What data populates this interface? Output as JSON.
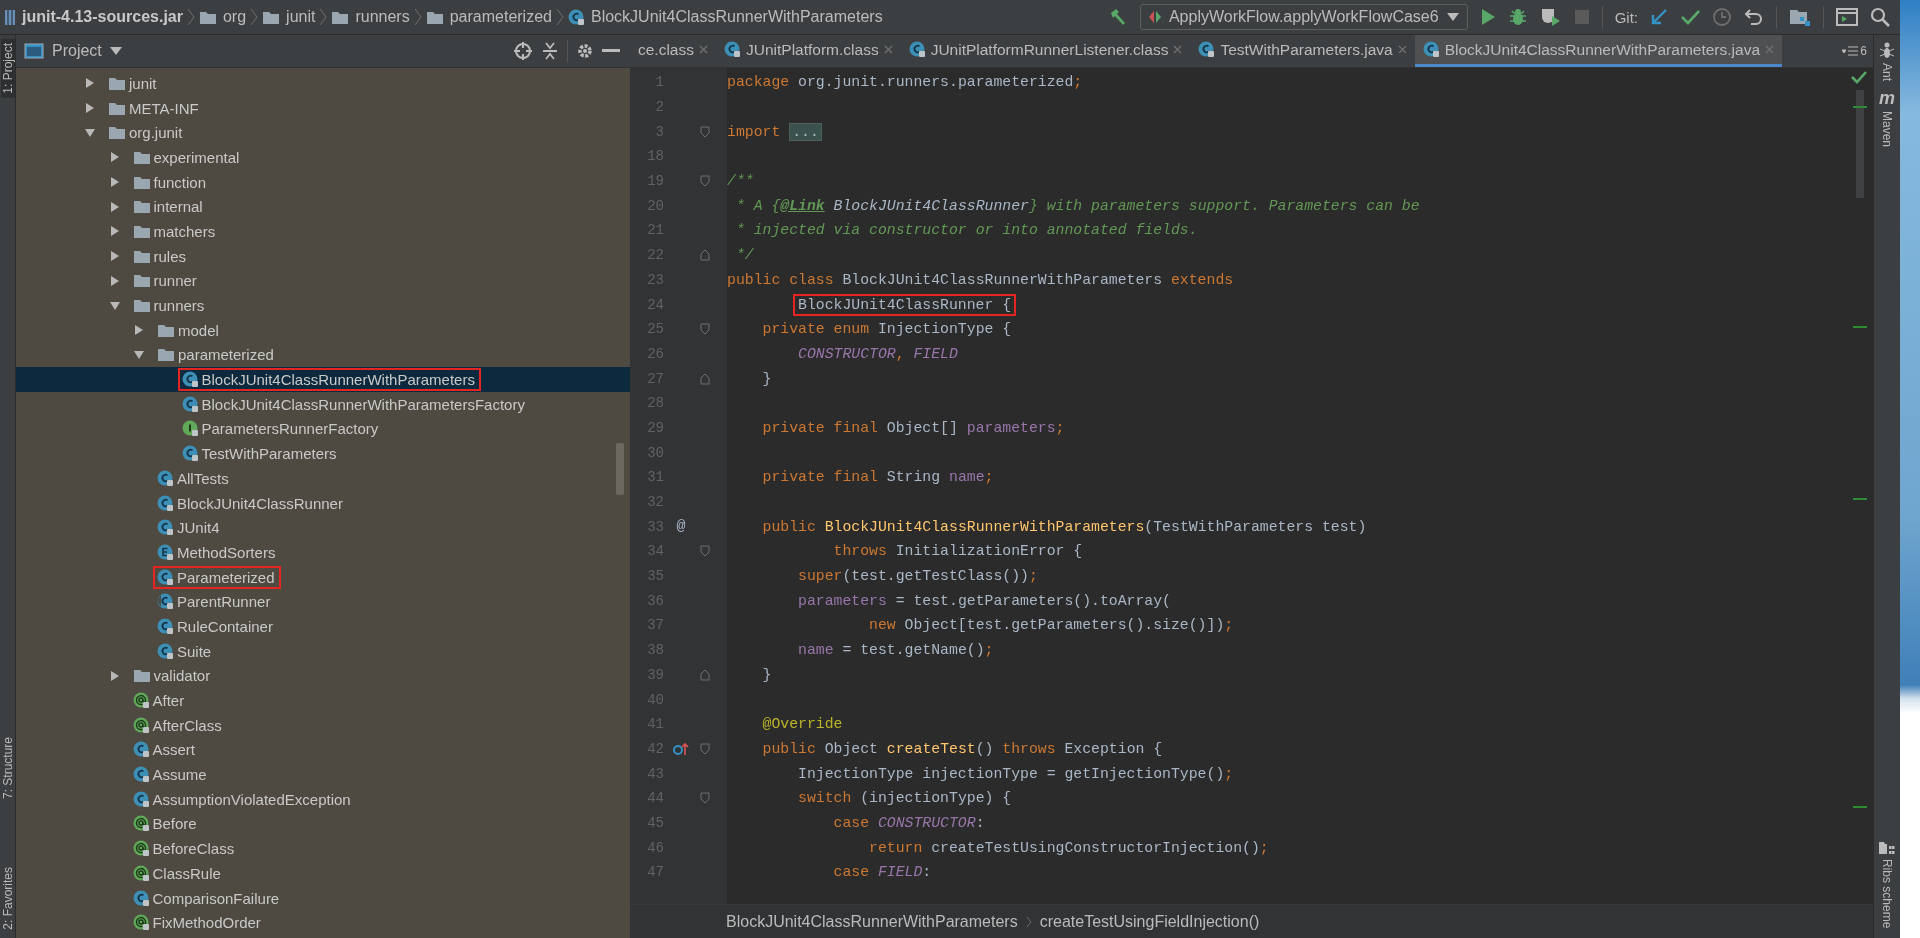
{
  "breadcrumb": [
    {
      "kind": "jar",
      "label": "junit-4.13-sources.jar"
    },
    {
      "kind": "folder",
      "label": "org"
    },
    {
      "kind": "folder",
      "label": "junit"
    },
    {
      "kind": "folder",
      "label": "runners"
    },
    {
      "kind": "folder",
      "label": "parameterized"
    },
    {
      "kind": "class",
      "label": "BlockJUnit4ClassRunnerWithParameters"
    }
  ],
  "toolbar": {
    "run_config": "ApplyWorkFlow.applyWorkFlowCase6",
    "git_label": "Git:"
  },
  "left_tool_strip": [
    {
      "label": "1: Project",
      "selected": true
    },
    {
      "label": "7: Structure",
      "selected": false
    },
    {
      "label": "2: Favorites",
      "selected": false
    }
  ],
  "project_panel": {
    "title": "Project",
    "tree": [
      {
        "kind": "folder",
        "label": "junit",
        "expanded": false
      },
      {
        "kind": "folder",
        "label": "META-INF",
        "expanded": false
      },
      {
        "kind": "folder",
        "label": "org.junit",
        "expanded": true,
        "children": [
          {
            "kind": "folder",
            "label": "experimental",
            "expanded": false
          },
          {
            "kind": "folder",
            "label": "function",
            "expanded": false
          },
          {
            "kind": "folder",
            "label": "internal",
            "expanded": false
          },
          {
            "kind": "folder",
            "label": "matchers",
            "expanded": false
          },
          {
            "kind": "folder",
            "label": "rules",
            "expanded": false
          },
          {
            "kind": "folder",
            "label": "runner",
            "expanded": false
          },
          {
            "kind": "folder",
            "label": "runners",
            "expanded": true,
            "children": [
              {
                "kind": "folder",
                "label": "model",
                "expanded": false
              },
              {
                "kind": "folder",
                "label": "parameterized",
                "expanded": true,
                "children": [
                  {
                    "kind": "class",
                    "label": "BlockJUnit4ClassRunnerWithParameters",
                    "selected": true,
                    "highlighted": true
                  },
                  {
                    "kind": "class",
                    "label": "BlockJUnit4ClassRunnerWithParametersFactory",
                    "selected": false,
                    "highlighted": false
                  },
                  {
                    "kind": "interface",
                    "label": "ParametersRunnerFactory",
                    "selected": false,
                    "highlighted": false
                  },
                  {
                    "kind": "class",
                    "label": "TestWithParameters",
                    "selected": false,
                    "highlighted": false
                  }
                ]
              },
              {
                "kind": "class",
                "label": "AllTests",
                "selected": false,
                "highlighted": false
              },
              {
                "kind": "class",
                "label": "BlockJUnit4ClassRunner",
                "selected": false,
                "highlighted": false
              },
              {
                "kind": "class",
                "label": "JUnit4",
                "selected": false,
                "highlighted": false
              },
              {
                "kind": "enum",
                "label": "MethodSorters",
                "selected": false,
                "highlighted": false
              },
              {
                "kind": "class",
                "label": "Parameterized",
                "selected": false,
                "highlighted": true
              },
              {
                "kind": "abstract",
                "label": "ParentRunner",
                "selected": false,
                "highlighted": false
              },
              {
                "kind": "class",
                "label": "RuleContainer",
                "selected": false,
                "highlighted": false
              },
              {
                "kind": "class",
                "label": "Suite",
                "selected": false,
                "highlighted": false
              }
            ]
          },
          {
            "kind": "folder",
            "label": "validator",
            "expanded": false
          },
          {
            "kind": "annotation",
            "label": "After",
            "selected": false,
            "highlighted": false
          },
          {
            "kind": "annotation",
            "label": "AfterClass",
            "selected": false,
            "highlighted": false
          },
          {
            "kind": "class",
            "label": "Assert",
            "selected": false,
            "highlighted": false
          },
          {
            "kind": "class",
            "label": "Assume",
            "selected": false,
            "highlighted": false
          },
          {
            "kind": "class",
            "label": "AssumptionViolatedException",
            "selected": false,
            "highlighted": false
          },
          {
            "kind": "annotation",
            "label": "Before",
            "selected": false,
            "highlighted": false
          },
          {
            "kind": "annotation",
            "label": "BeforeClass",
            "selected": false,
            "highlighted": false
          },
          {
            "kind": "annotation",
            "label": "ClassRule",
            "selected": false,
            "highlighted": false
          },
          {
            "kind": "class",
            "label": "ComparisonFailure",
            "selected": false,
            "highlighted": false
          },
          {
            "kind": "annotation",
            "label": "FixMethodOrder",
            "selected": false,
            "highlighted": false
          }
        ]
      }
    ]
  },
  "editor": {
    "tabs": [
      {
        "label": "ce.class",
        "has_icon": false,
        "selected": false
      },
      {
        "label": "JUnitPlatform.class",
        "has_icon": true,
        "selected": false
      },
      {
        "label": "JUnitPlatformRunnerListener.class",
        "has_icon": true,
        "selected": false
      },
      {
        "label": "TestWithParameters.java",
        "has_icon": true,
        "selected": false
      },
      {
        "label": "BlockJUnit4ClassRunnerWithParameters.java",
        "has_icon": true,
        "selected": true
      }
    ],
    "overflow_count": "6",
    "lines": [
      {
        "number": "1",
        "fold_start": false,
        "fold_end": false,
        "segments": [
          {
            "kind": "keyword",
            "text": "package"
          },
          {
            "kind": "plain",
            "text": " org.junit.runners.parameterized"
          },
          {
            "kind": "keyword",
            "text": ";"
          }
        ]
      },
      {
        "number": "2",
        "fold_start": false,
        "fold_end": false
      },
      {
        "number": "3",
        "fold_start": true,
        "fold_end": false,
        "segments": [
          {
            "kind": "keyword",
            "text": "import "
          },
          {
            "kind": "folded",
            "text": "..."
          }
        ]
      },
      {
        "number": "18",
        "fold_start": false,
        "fold_end": false
      },
      {
        "number": "19",
        "fold_start": true,
        "fold_end": false,
        "segments": [
          {
            "kind": "comment",
            "text": "/**"
          }
        ]
      },
      {
        "number": "20",
        "fold_start": false,
        "fold_end": false,
        "segments": [
          {
            "kind": "comment",
            "text": " * A {"
          },
          {
            "kind": "doc_tag",
            "text": "@Link"
          },
          {
            "kind": "doc_ref",
            "text": " BlockJUnit4ClassRunner"
          },
          {
            "kind": "comment",
            "text": "} with parameters support. Parameters can be"
          }
        ]
      },
      {
        "number": "21",
        "fold_start": false,
        "fold_end": false,
        "segments": [
          {
            "kind": "comment",
            "text": " * injected via constructor or into annotated fields."
          }
        ]
      },
      {
        "number": "22",
        "fold_start": false,
        "fold_end": true,
        "segments": [
          {
            "kind": "comment",
            "text": " */"
          }
        ]
      },
      {
        "number": "23",
        "fold_start": false,
        "fold_end": false,
        "segments": [
          {
            "kind": "keyword",
            "text": "public class "
          },
          {
            "kind": "plain",
            "text": "BlockJUnit4ClassRunnerWithParameters "
          },
          {
            "kind": "keyword",
            "text": "extends"
          }
        ]
      },
      {
        "number": "24",
        "fold_start": false,
        "fold_end": false,
        "wrapped": true,
        "segments": [
          {
            "kind": "plain",
            "text": "BlockJUnit4ClassRunner {",
            "highlighted": true
          }
        ]
      },
      {
        "number": "25",
        "fold_start": true,
        "fold_end": false,
        "segments": [
          {
            "kind": "keyword",
            "text": "    private enum "
          },
          {
            "kind": "plain",
            "text": "InjectionType {"
          }
        ]
      },
      {
        "number": "26",
        "fold_start": false,
        "fold_end": false,
        "segments": [
          {
            "kind": "constant",
            "text": "        CONSTRUCTOR"
          },
          {
            "kind": "keyword",
            "text": ", "
          },
          {
            "kind": "constant",
            "text": "FIELD"
          }
        ]
      },
      {
        "number": "27",
        "fold_start": false,
        "fold_end": true,
        "segments": [
          {
            "kind": "plain",
            "text": "    }"
          }
        ]
      },
      {
        "number": "28",
        "fold_start": false,
        "fold_end": false
      },
      {
        "number": "29",
        "fold_start": false,
        "fold_end": false,
        "segments": [
          {
            "kind": "keyword",
            "text": "    private final "
          },
          {
            "kind": "plain",
            "text": "Object[] "
          },
          {
            "kind": "field",
            "text": "parameters"
          },
          {
            "kind": "keyword",
            "text": ";"
          }
        ]
      },
      {
        "number": "30",
        "fold_start": false,
        "fold_end": false
      },
      {
        "number": "31",
        "fold_start": false,
        "fold_end": false,
        "segments": [
          {
            "kind": "keyword",
            "text": "    private final "
          },
          {
            "kind": "plain",
            "text": "String "
          },
          {
            "kind": "field",
            "text": "name"
          },
          {
            "kind": "keyword",
            "text": ";"
          }
        ]
      },
      {
        "number": "32",
        "fold_start": false,
        "fold_end": false
      },
      {
        "number": "33",
        "fold_start": false,
        "fold_end": false,
        "gutter_text": "@",
        "segments": [
          {
            "kind": "keyword",
            "text": "    public "
          },
          {
            "kind": "method",
            "text": "BlockJUnit4ClassRunnerWithParameters"
          },
          {
            "kind": "plain",
            "text": "(TestWithParameters test)"
          }
        ]
      },
      {
        "number": "34",
        "fold_start": true,
        "fold_end": false,
        "segments": [
          {
            "kind": "keyword",
            "text": "            throws "
          },
          {
            "kind": "plain",
            "text": "InitializationError {"
          }
        ]
      },
      {
        "number": "35",
        "fold_start": false,
        "fold_end": false,
        "segments": [
          {
            "kind": "keyword",
            "text": "        super"
          },
          {
            "kind": "plain",
            "text": "(test.getTestClass())"
          },
          {
            "kind": "keyword",
            "text": ";"
          }
        ]
      },
      {
        "number": "36",
        "fold_start": false,
        "fold_end": false,
        "segments": [
          {
            "kind": "field",
            "text": "        parameters"
          },
          {
            "kind": "plain",
            "text": " = test.getParameters().toArray("
          }
        ]
      },
      {
        "number": "37",
        "fold_start": false,
        "fold_end": false,
        "segments": [
          {
            "kind": "keyword",
            "text": "                new "
          },
          {
            "kind": "plain",
            "text": "Object[test.getParameters().size()])"
          },
          {
            "kind": "keyword",
            "text": ";"
          }
        ]
      },
      {
        "number": "38",
        "fold_start": false,
        "fold_end": false,
        "segments": [
          {
            "kind": "field",
            "text": "        name"
          },
          {
            "kind": "plain",
            "text": " = test.getName()"
          },
          {
            "kind": "keyword",
            "text": ";"
          }
        ]
      },
      {
        "number": "39",
        "fold_start": false,
        "fold_end": true,
        "segments": [
          {
            "kind": "plain",
            "text": "    }"
          }
        ]
      },
      {
        "number": "40",
        "fold_start": false,
        "fold_end": false
      },
      {
        "number": "41",
        "fold_start": false,
        "fold_end": false,
        "segments": [
          {
            "kind": "annotation",
            "text": "    @Override"
          }
        ]
      },
      {
        "number": "42",
        "fold_start": true,
        "fold_end": false,
        "override": true,
        "segments": [
          {
            "kind": "keyword",
            "text": "    public "
          },
          {
            "kind": "plain",
            "text": "Object "
          },
          {
            "kind": "method",
            "text": "createTest"
          },
          {
            "kind": "plain",
            "text": "() "
          },
          {
            "kind": "keyword",
            "text": "throws "
          },
          {
            "kind": "plain",
            "text": "Exception {"
          }
        ]
      },
      {
        "number": "43",
        "fold_start": false,
        "fold_end": false,
        "segments": [
          {
            "kind": "plain",
            "text": "        InjectionType injectionType = getInjectionType()"
          },
          {
            "kind": "keyword",
            "text": ";"
          }
        ]
      },
      {
        "number": "44",
        "fold_start": true,
        "fold_end": false,
        "segments": [
          {
            "kind": "keyword",
            "text": "        switch "
          },
          {
            "kind": "plain",
            "text": "(injectionType) {"
          }
        ]
      },
      {
        "number": "45",
        "fold_start": false,
        "fold_end": false,
        "segments": [
          {
            "kind": "keyword",
            "text": "            case "
          },
          {
            "kind": "constant",
            "text": "CONSTRUCTOR"
          },
          {
            "kind": "plain",
            "text": ":"
          }
        ]
      },
      {
        "number": "46",
        "fold_start": false,
        "fold_end": false,
        "segments": [
          {
            "kind": "keyword",
            "text": "                return "
          },
          {
            "kind": "plain",
            "text": "createTestUsingConstructorInjection()"
          },
          {
            "kind": "keyword",
            "text": ";"
          }
        ]
      },
      {
        "number": "47",
        "fold_start": false,
        "fold_end": false,
        "segments": [
          {
            "kind": "keyword",
            "text": "            case "
          },
          {
            "kind": "constant",
            "text": "FIELD"
          },
          {
            "kind": "plain",
            "text": ":"
          }
        ]
      }
    ],
    "breadcrumb": [
      "BlockJUnit4ClassRunnerWithParameters",
      "createTestUsingFieldInjection()"
    ]
  },
  "right_tool_strip": [
    {
      "kind": "ant",
      "label": "Ant"
    },
    {
      "kind": "maven",
      "label": "Maven",
      "icon_text": "m"
    },
    {
      "kind": "ribs",
      "label": "Ribs scheme"
    }
  ]
}
